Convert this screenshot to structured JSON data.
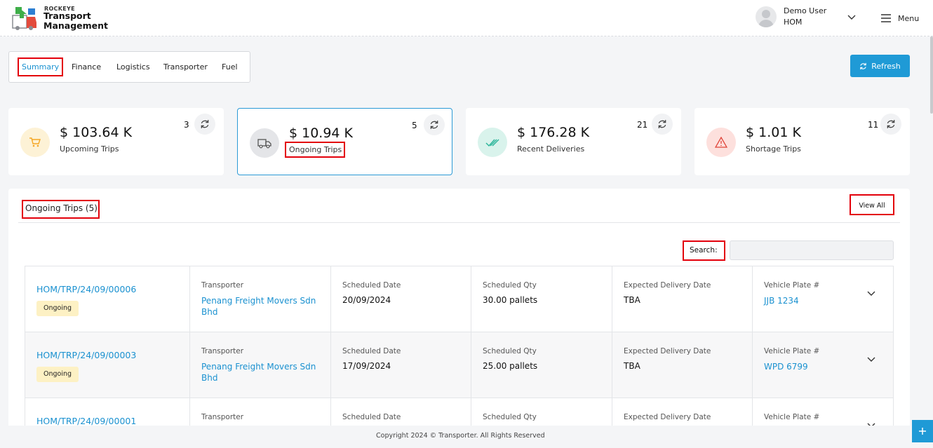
{
  "brand": {
    "small": "ROCKEYE",
    "line1": "Transport",
    "line2": "Management"
  },
  "user": {
    "name": "Demo User",
    "role": "HOM"
  },
  "menu_label": "Menu",
  "tabs": [
    {
      "label": "Summary",
      "active": true
    },
    {
      "label": "Finance"
    },
    {
      "label": "Logistics"
    },
    {
      "label": "Transporter"
    },
    {
      "label": "Fuel"
    }
  ],
  "refresh_label": "Refresh",
  "cards": [
    {
      "amount": "$ 103.64 K",
      "label": "Upcoming Trips",
      "count": "3",
      "icon": "cart-icon",
      "color": "#f5a623"
    },
    {
      "amount": "$ 10.94 K",
      "label": "Ongoing Trips",
      "count": "5",
      "icon": "truck-icon",
      "color": "#555555"
    },
    {
      "amount": "$ 176.28 K",
      "label": "Recent Deliveries",
      "count": "21",
      "icon": "double-check-icon",
      "color": "#2bb59a"
    },
    {
      "amount": "$ 1.01 K",
      "label": "Shortage Trips",
      "count": "11",
      "icon": "warning-icon",
      "color": "#e0453a"
    }
  ],
  "panel": {
    "title": "Ongoing Trips (5)",
    "view_all": "View All",
    "search_label": "Search:"
  },
  "columns": {
    "transporter": "Transporter",
    "scheduled_date": "Scheduled Date",
    "scheduled_qty": "Scheduled Qty",
    "expected_delivery": "Expected Delivery Date",
    "vehicle_plate": "Vehicle Plate #"
  },
  "trips": [
    {
      "id": "HOM/TRP/24/09/00006",
      "status": "Ongoing",
      "transporter": "Penang Freight Movers Sdn Bhd",
      "scheduled_date": "20/09/2024",
      "scheduled_qty": "30.00 pallets",
      "expected_delivery": "TBA",
      "vehicle_plate": "JJB 1234"
    },
    {
      "id": "HOM/TRP/24/09/00003",
      "status": "Ongoing",
      "transporter": "Penang Freight Movers Sdn Bhd",
      "scheduled_date": "17/09/2024",
      "scheduled_qty": "25.00 pallets",
      "expected_delivery": "TBA",
      "vehicle_plate": "WPD 6799"
    },
    {
      "id": "HOM/TRP/24/09/00001"
    }
  ],
  "footer": "Copyright 2024 © Transporter. All Rights Reserved",
  "colors": {
    "accent": "#1f9ad6",
    "highlight_box": "#e3000b",
    "status_badge": "#fdf1c4"
  }
}
